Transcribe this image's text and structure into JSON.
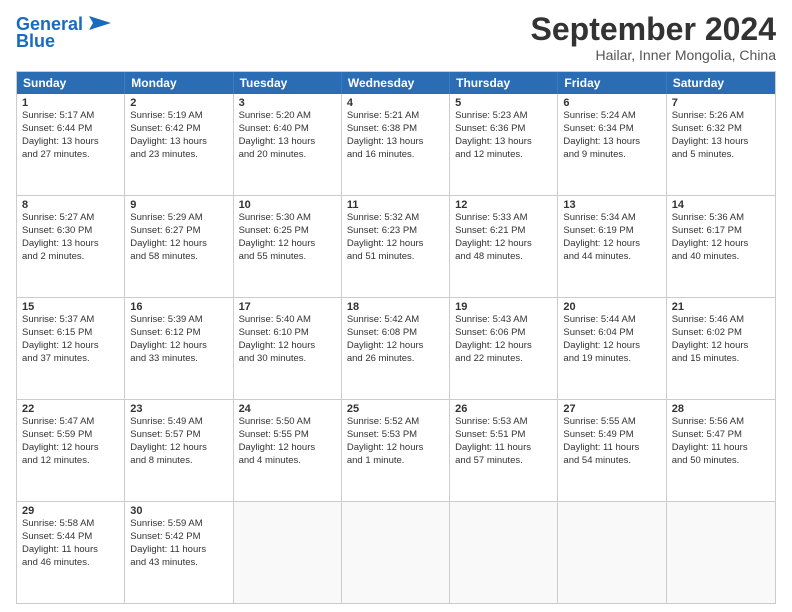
{
  "logo": {
    "text1": "General",
    "text2": "Blue"
  },
  "title": "September 2024",
  "subtitle": "Hailar, Inner Mongolia, China",
  "header_days": [
    "Sunday",
    "Monday",
    "Tuesday",
    "Wednesday",
    "Thursday",
    "Friday",
    "Saturday"
  ],
  "rows": [
    [
      {
        "day": "1",
        "lines": [
          "Sunrise: 5:17 AM",
          "Sunset: 6:44 PM",
          "Daylight: 13 hours",
          "and 27 minutes."
        ]
      },
      {
        "day": "2",
        "lines": [
          "Sunrise: 5:19 AM",
          "Sunset: 6:42 PM",
          "Daylight: 13 hours",
          "and 23 minutes."
        ]
      },
      {
        "day": "3",
        "lines": [
          "Sunrise: 5:20 AM",
          "Sunset: 6:40 PM",
          "Daylight: 13 hours",
          "and 20 minutes."
        ]
      },
      {
        "day": "4",
        "lines": [
          "Sunrise: 5:21 AM",
          "Sunset: 6:38 PM",
          "Daylight: 13 hours",
          "and 16 minutes."
        ]
      },
      {
        "day": "5",
        "lines": [
          "Sunrise: 5:23 AM",
          "Sunset: 6:36 PM",
          "Daylight: 13 hours",
          "and 12 minutes."
        ]
      },
      {
        "day": "6",
        "lines": [
          "Sunrise: 5:24 AM",
          "Sunset: 6:34 PM",
          "Daylight: 13 hours",
          "and 9 minutes."
        ]
      },
      {
        "day": "7",
        "lines": [
          "Sunrise: 5:26 AM",
          "Sunset: 6:32 PM",
          "Daylight: 13 hours",
          "and 5 minutes."
        ]
      }
    ],
    [
      {
        "day": "8",
        "lines": [
          "Sunrise: 5:27 AM",
          "Sunset: 6:30 PM",
          "Daylight: 13 hours",
          "and 2 minutes."
        ]
      },
      {
        "day": "9",
        "lines": [
          "Sunrise: 5:29 AM",
          "Sunset: 6:27 PM",
          "Daylight: 12 hours",
          "and 58 minutes."
        ]
      },
      {
        "day": "10",
        "lines": [
          "Sunrise: 5:30 AM",
          "Sunset: 6:25 PM",
          "Daylight: 12 hours",
          "and 55 minutes."
        ]
      },
      {
        "day": "11",
        "lines": [
          "Sunrise: 5:32 AM",
          "Sunset: 6:23 PM",
          "Daylight: 12 hours",
          "and 51 minutes."
        ]
      },
      {
        "day": "12",
        "lines": [
          "Sunrise: 5:33 AM",
          "Sunset: 6:21 PM",
          "Daylight: 12 hours",
          "and 48 minutes."
        ]
      },
      {
        "day": "13",
        "lines": [
          "Sunrise: 5:34 AM",
          "Sunset: 6:19 PM",
          "Daylight: 12 hours",
          "and 44 minutes."
        ]
      },
      {
        "day": "14",
        "lines": [
          "Sunrise: 5:36 AM",
          "Sunset: 6:17 PM",
          "Daylight: 12 hours",
          "and 40 minutes."
        ]
      }
    ],
    [
      {
        "day": "15",
        "lines": [
          "Sunrise: 5:37 AM",
          "Sunset: 6:15 PM",
          "Daylight: 12 hours",
          "and 37 minutes."
        ]
      },
      {
        "day": "16",
        "lines": [
          "Sunrise: 5:39 AM",
          "Sunset: 6:12 PM",
          "Daylight: 12 hours",
          "and 33 minutes."
        ]
      },
      {
        "day": "17",
        "lines": [
          "Sunrise: 5:40 AM",
          "Sunset: 6:10 PM",
          "Daylight: 12 hours",
          "and 30 minutes."
        ]
      },
      {
        "day": "18",
        "lines": [
          "Sunrise: 5:42 AM",
          "Sunset: 6:08 PM",
          "Daylight: 12 hours",
          "and 26 minutes."
        ]
      },
      {
        "day": "19",
        "lines": [
          "Sunrise: 5:43 AM",
          "Sunset: 6:06 PM",
          "Daylight: 12 hours",
          "and 22 minutes."
        ]
      },
      {
        "day": "20",
        "lines": [
          "Sunrise: 5:44 AM",
          "Sunset: 6:04 PM",
          "Daylight: 12 hours",
          "and 19 minutes."
        ]
      },
      {
        "day": "21",
        "lines": [
          "Sunrise: 5:46 AM",
          "Sunset: 6:02 PM",
          "Daylight: 12 hours",
          "and 15 minutes."
        ]
      }
    ],
    [
      {
        "day": "22",
        "lines": [
          "Sunrise: 5:47 AM",
          "Sunset: 5:59 PM",
          "Daylight: 12 hours",
          "and 12 minutes."
        ]
      },
      {
        "day": "23",
        "lines": [
          "Sunrise: 5:49 AM",
          "Sunset: 5:57 PM",
          "Daylight: 12 hours",
          "and 8 minutes."
        ]
      },
      {
        "day": "24",
        "lines": [
          "Sunrise: 5:50 AM",
          "Sunset: 5:55 PM",
          "Daylight: 12 hours",
          "and 4 minutes."
        ]
      },
      {
        "day": "25",
        "lines": [
          "Sunrise: 5:52 AM",
          "Sunset: 5:53 PM",
          "Daylight: 12 hours",
          "and 1 minute."
        ]
      },
      {
        "day": "26",
        "lines": [
          "Sunrise: 5:53 AM",
          "Sunset: 5:51 PM",
          "Daylight: 11 hours",
          "and 57 minutes."
        ]
      },
      {
        "day": "27",
        "lines": [
          "Sunrise: 5:55 AM",
          "Sunset: 5:49 PM",
          "Daylight: 11 hours",
          "and 54 minutes."
        ]
      },
      {
        "day": "28",
        "lines": [
          "Sunrise: 5:56 AM",
          "Sunset: 5:47 PM",
          "Daylight: 11 hours",
          "and 50 minutes."
        ]
      }
    ],
    [
      {
        "day": "29",
        "lines": [
          "Sunrise: 5:58 AM",
          "Sunset: 5:44 PM",
          "Daylight: 11 hours",
          "and 46 minutes."
        ]
      },
      {
        "day": "30",
        "lines": [
          "Sunrise: 5:59 AM",
          "Sunset: 5:42 PM",
          "Daylight: 11 hours",
          "and 43 minutes."
        ]
      },
      {
        "day": "",
        "lines": []
      },
      {
        "day": "",
        "lines": []
      },
      {
        "day": "",
        "lines": []
      },
      {
        "day": "",
        "lines": []
      },
      {
        "day": "",
        "lines": []
      }
    ]
  ]
}
